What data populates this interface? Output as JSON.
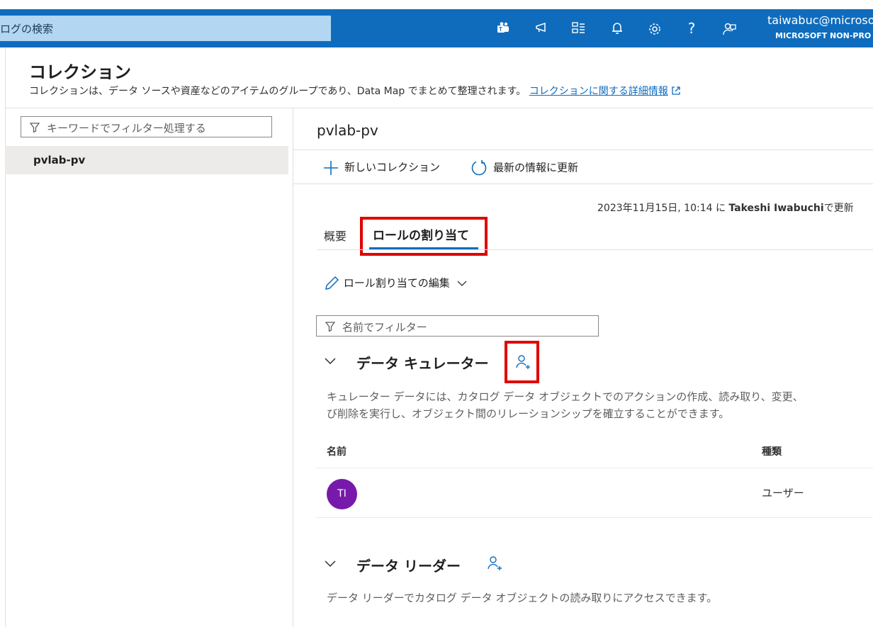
{
  "header": {
    "search_text": "ログの検索",
    "user_email": "taiwabuc@microso",
    "user_org": "MICROSOFT NON-PRO",
    "icons": [
      "teams-icon",
      "megaphone-icon",
      "directory-icon",
      "bell-icon",
      "gear-icon",
      "help-icon",
      "feedback-icon"
    ],
    "accent": "#0f6cbd"
  },
  "page": {
    "title": "コレクション",
    "description": "コレクションは、データ ソースや資産などのアイテムのグループであり、Data Map でまとめて整理されます。",
    "learn_more": "コレクションに関する詳細情報"
  },
  "sidebar": {
    "filter_placeholder": "キーワードでフィルター処理する",
    "items": [
      {
        "label": "pvlab-pv"
      }
    ]
  },
  "collection": {
    "name": "pvlab-pv",
    "new_collection": "新しいコレクション",
    "refresh": "最新の情報に更新",
    "updated_prefix": "2023年11月15日, 10:14 に ",
    "updated_user": "Takeshi Iwabuchi",
    "updated_suffix": "で更新",
    "tabs": [
      {
        "label": "概要"
      },
      {
        "label": "ロールの割り当て",
        "selected": true
      }
    ],
    "edit_roles": "ロール割り当ての編集",
    "name_filter_placeholder": "名前でフィルター",
    "sections": [
      {
        "title": "データ キュレーター",
        "description_line1": "キュレーター データには、カタログ データ オブジェクトでのアクションの作成、読み取り、変更、",
        "description_line2": "び削除を実行し、オブジェクト間のリレーションシップを確立することができます。",
        "columns": [
          "名前",
          "種類"
        ],
        "rows": [
          {
            "initials": "TI",
            "type": "ユーザー"
          }
        ]
      },
      {
        "title": "データ リーダー",
        "description_line1": "データ リーダーでカタログ データ オブジェクトの読み取りにアクセスできます。"
      }
    ]
  },
  "highlight_color": "#e00000"
}
